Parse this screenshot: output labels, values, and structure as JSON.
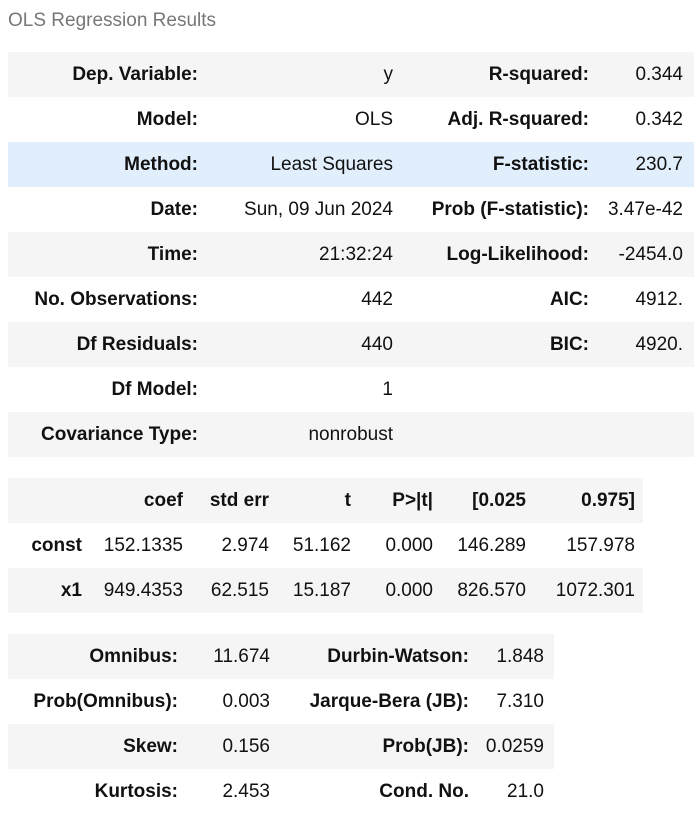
{
  "caption": "OLS Regression Results",
  "summary": {
    "rows": [
      {
        "l1": "Dep. Variable:",
        "v1": "y",
        "l2": "R-squared:",
        "v2": "0.344"
      },
      {
        "l1": "Model:",
        "v1": "OLS",
        "l2": "Adj. R-squared:",
        "v2": "0.342"
      },
      {
        "l1": "Method:",
        "v1": "Least Squares",
        "l2": "F-statistic:",
        "v2": "230.7"
      },
      {
        "l1": "Date:",
        "v1": "Sun, 09 Jun 2024",
        "l2": "Prob (F-statistic):",
        "v2": "3.47e-42"
      },
      {
        "l1": "Time:",
        "v1": "21:32:24",
        "l2": "Log-Likelihood:",
        "v2": "-2454.0"
      },
      {
        "l1": "No. Observations:",
        "v1": "442",
        "l2": "AIC:",
        "v2": "4912."
      },
      {
        "l1": "Df Residuals:",
        "v1": "440",
        "l2": "BIC:",
        "v2": "4920."
      },
      {
        "l1": "Df Model:",
        "v1": "1",
        "l2": "",
        "v2": ""
      },
      {
        "l1": "Covariance Type:",
        "v1": "nonrobust",
        "l2": "",
        "v2": ""
      }
    ]
  },
  "coefficients": {
    "headers": [
      "",
      "coef",
      "std err",
      "t",
      "P>|t|",
      "[0.025",
      "0.975]"
    ],
    "rows": [
      {
        "name": "const",
        "coef": "152.1335",
        "std_err": "2.974",
        "t": "51.162",
        "p": "0.000",
        "ci_low": "146.289",
        "ci_high": "157.978"
      },
      {
        "name": "x1",
        "coef": "949.4353",
        "std_err": "62.515",
        "t": "15.187",
        "p": "0.000",
        "ci_low": "826.570",
        "ci_high": "1072.301"
      }
    ]
  },
  "diagnostics": {
    "rows": [
      {
        "l1": "Omnibus:",
        "v1": "11.674",
        "l2": "Durbin-Watson:",
        "v2": "1.848"
      },
      {
        "l1": "Prob(Omnibus):",
        "v1": "0.003",
        "l2": "Jarque-Bera (JB):",
        "v2": "7.310"
      },
      {
        "l1": "Skew:",
        "v1": "0.156",
        "l2": "Prob(JB):",
        "v2": "0.0259"
      },
      {
        "l1": "Kurtosis:",
        "v1": "2.453",
        "l2": "Cond. No.",
        "v2": "21.0"
      }
    ]
  },
  "colors": {
    "caption": "#777777",
    "row_stripe": "#f5f5f5",
    "row_highlight": "#e1eefb"
  }
}
